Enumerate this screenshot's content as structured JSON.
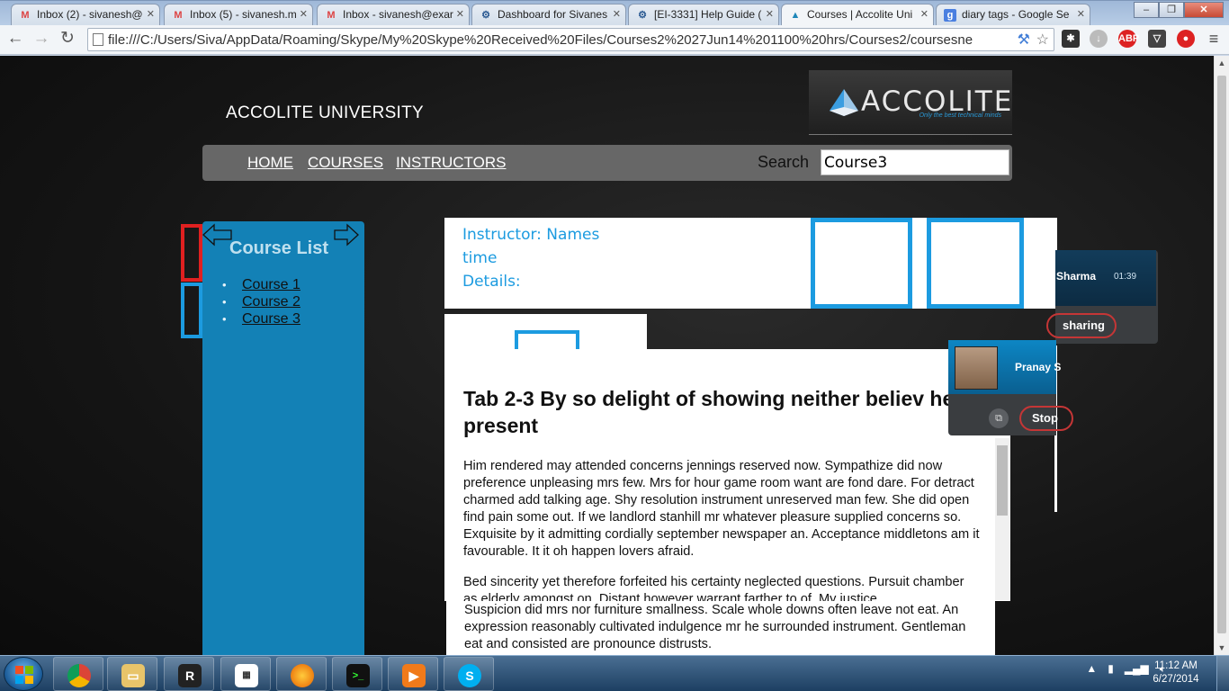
{
  "browser": {
    "tabs": [
      {
        "label": "Inbox (2) - sivanesh@",
        "icon": "gmail-icon",
        "badge": "2"
      },
      {
        "label": "Inbox (5) - sivanesh.m",
        "icon": "gmail-icon",
        "badge": "5"
      },
      {
        "label": "Inbox - sivanesh@exar",
        "icon": "gmail-icon",
        "badge": "0"
      },
      {
        "label": "Dashboard for Sivanes",
        "icon": "jira-icon"
      },
      {
        "label": "[EI-3331] Help Guide (",
        "icon": "jira-icon"
      },
      {
        "label": "Courses | Accolite Uni",
        "icon": "accolite-icon",
        "active": true
      },
      {
        "label": "diary tags - Google Se",
        "icon": "google-icon"
      }
    ],
    "url": "file:///C:/Users/Siva/AppData/Roaming/Skype/My%20Skype%20Received%20Files/Courses2%2027Jun14%201100%20hrs/Courses2/coursesne",
    "extensions": [
      "abp-icon",
      "pocket-icon",
      "onetab-icon",
      "lastpass-icon"
    ]
  },
  "page": {
    "site_title": "ACCOLITE UNIVERSITY",
    "logo": {
      "wordmark": "ACCOLITE",
      "tagline": "Only the best technical minds"
    },
    "nav": {
      "home": "HOME",
      "courses": "COURSES",
      "instructors": "INSTRUCTORS"
    },
    "search": {
      "label": "Search",
      "value": "Course3"
    },
    "sidebar": {
      "title": "Course List",
      "courses": [
        "Course 1",
        "Course 2",
        "Course 3"
      ]
    },
    "instructor": {
      "line1": "Instructor: Names",
      "line2": "time",
      "line3": "Details:"
    },
    "content": {
      "heading": "Tab 2-3 By so delight of showing neither believ he present",
      "paragraph1": "Him rendered may attended concerns jennings reserved now. Sympathize did now preference unpleasing mrs few. Mrs for hour game room want are fond dare. For detract charmed add talking age. Shy resolution instrument unreserved man few. She did open find pain some out. If we landlord stanhill mr whatever pleasure supplied concerns so. Exquisite by it admitting cordially september newspaper an. Acceptance middletons am it favourable. It it oh happen lovers afraid.",
      "paragraph2": "Bed sincerity yet therefore forfeited his certainty neglected questions. Pursuit chamber as elderly amongst on. Distant however warrant farther to of. My justice",
      "paragraph3": "Suspicion did mrs nor furniture smallness. Scale whole downs often leave not eat. An expression reasonably cultivated indulgence mr he surrounded instrument. Gentleman eat and consisted are pronounce distrusts."
    }
  },
  "skype": {
    "call1": {
      "name": "Sharma",
      "timer": "01:39",
      "stop_label": "sharing"
    },
    "call2": {
      "name": "Pranay S",
      "stop_label": "Stop"
    }
  },
  "taskbar": {
    "apps": [
      "chrome-icon",
      "explorer-icon",
      "mremoteng-icon",
      "calculator-icon",
      "firefox-icon",
      "console-icon",
      "media-player-icon",
      "skype-icon"
    ],
    "clock_time": "11:12 AM",
    "clock_date": "6/27/2014"
  },
  "colors": {
    "accent_blue": "#1c9be0",
    "sidebar_blue": "#1381b6",
    "handle_red": "#e02020",
    "nav_gray": "#676767"
  }
}
